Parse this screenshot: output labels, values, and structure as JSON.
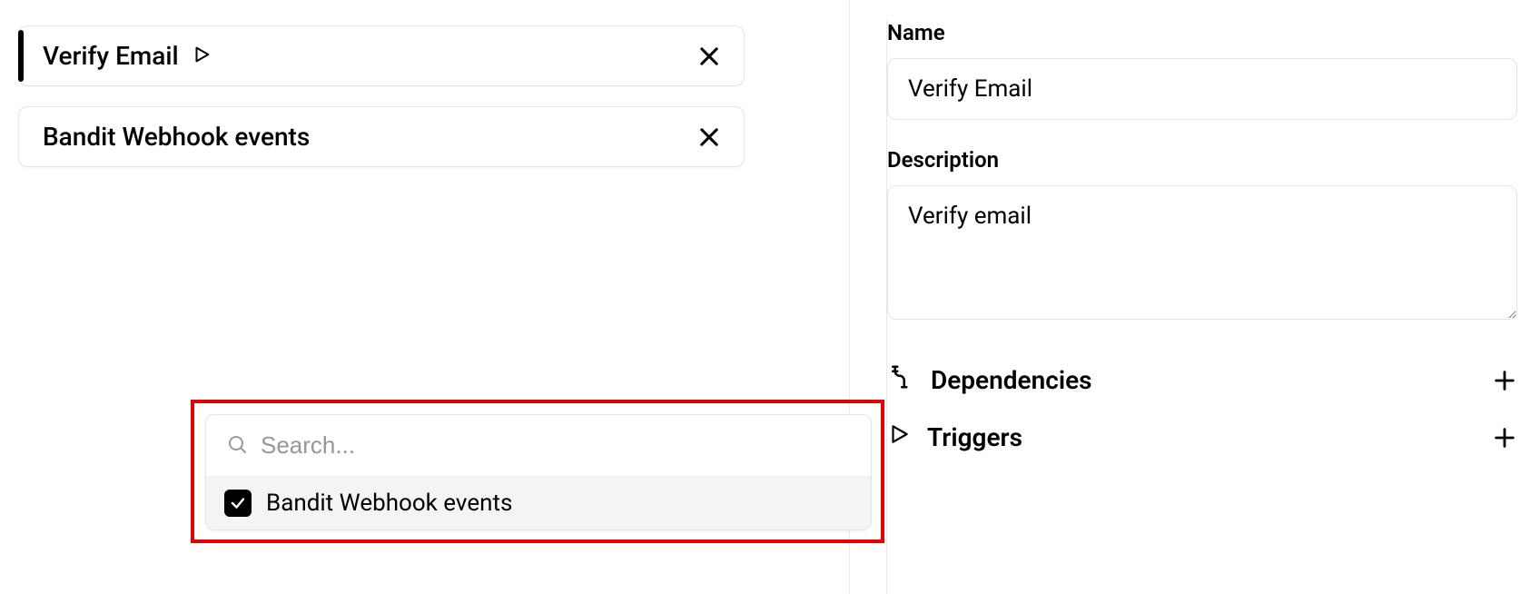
{
  "left": {
    "cards": [
      {
        "title": "Verify Email",
        "selected": true,
        "has_play_icon": true
      },
      {
        "title": "Bandit Webhook events",
        "selected": false,
        "has_play_icon": false
      }
    ]
  },
  "dropdown": {
    "search_placeholder": "Search...",
    "options": [
      {
        "label": "Bandit Webhook events",
        "checked": true
      }
    ]
  },
  "panel": {
    "name_label": "Name",
    "name_value": "Verify Email",
    "description_label": "Description",
    "description_value": "Verify email",
    "sections": [
      {
        "icon": "dependencies-icon",
        "label": "Dependencies"
      },
      {
        "icon": "play-icon",
        "label": "Triggers"
      }
    ]
  }
}
